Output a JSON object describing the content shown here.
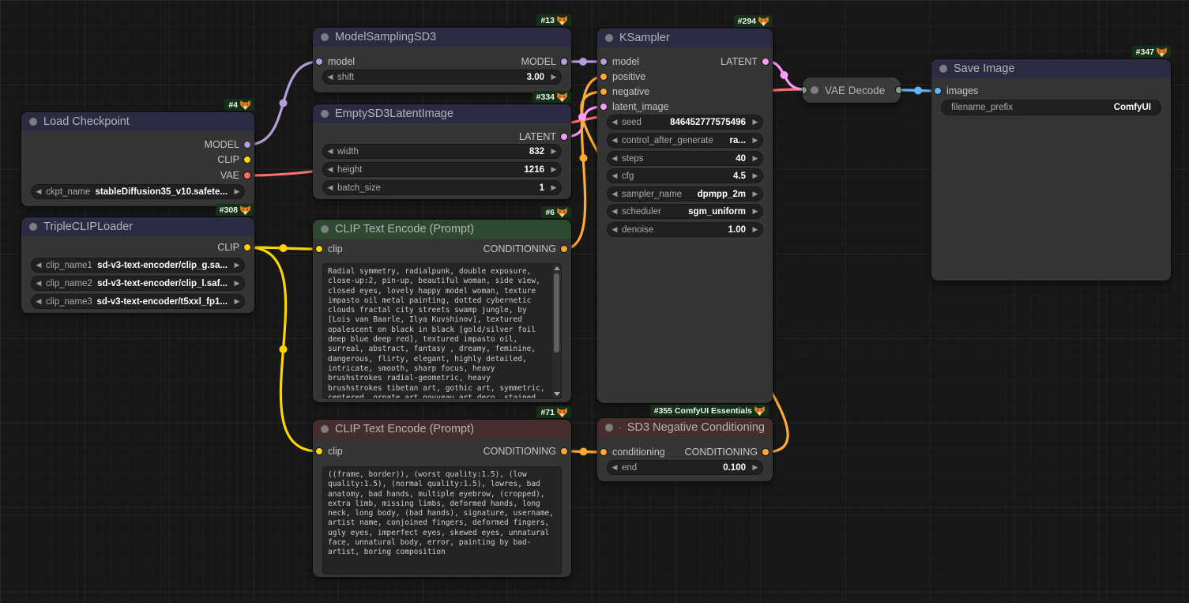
{
  "colors": {
    "model": "#B39DDB",
    "clip": "#FFD500",
    "vae": "#FF6E6E",
    "latent": "#FF9CF9",
    "conditioning": "#FFA931",
    "image": "#64B5F6",
    "collapsed_slot": "#80A080",
    "badge_bg": "#143016",
    "header_default": "#2b2b44",
    "header_positive": "#2d4a31",
    "header_negative": "#472e2e"
  },
  "nodes": {
    "load_checkpoint": {
      "badge": "#4",
      "title": "Load Checkpoint",
      "outputs": [
        "MODEL",
        "CLIP",
        "VAE"
      ],
      "widgets": [
        {
          "label": "ckpt_name",
          "value": "stableDiffusion35_v10.safete..."
        }
      ]
    },
    "triple_clip_loader": {
      "badge": "#308",
      "title": "TripleCLIPLoader",
      "outputs": [
        "CLIP"
      ],
      "widgets": [
        {
          "label": "clip_name1",
          "value": "sd-v3-text-encoder/clip_g.sa..."
        },
        {
          "label": "clip_name2",
          "value": "sd-v3-text-encoder/clip_l.saf..."
        },
        {
          "label": "clip_name3",
          "value": "sd-v3-text-encoder/t5xxl_fp1..."
        }
      ]
    },
    "model_sampling_sd3": {
      "badge": "#13",
      "title": "ModelSamplingSD3",
      "inputs": [
        "model"
      ],
      "outputs": [
        "MODEL"
      ],
      "widgets": [
        {
          "label": "shift",
          "value": "3.00"
        }
      ]
    },
    "empty_latent": {
      "badge": "#334",
      "title": "EmptySD3LatentImage",
      "outputs": [
        "LATENT"
      ],
      "widgets": [
        {
          "label": "width",
          "value": "832"
        },
        {
          "label": "height",
          "value": "1216"
        },
        {
          "label": "batch_size",
          "value": "1"
        }
      ]
    },
    "clip_positive": {
      "badge": "#6",
      "title": "CLIP Text Encode (Prompt)",
      "inputs": [
        "clip"
      ],
      "outputs": [
        "CONDITIONING"
      ],
      "text": "Radial symmetry, radialpunk, double exposure, close-up:2, pin-up, beautiful woman, side view, closed eyes, lovely happy model woman, texture impasto oil metal painting, dotted cybernetic clouds fractal city streets swamp jungle, by [Lois van Baarle, Ilya Kuvshinov], textured opalescent on black in black [gold/silver foil deep blue deep red], textured impasto oil, surreal, abstract, fantasy , dreamy, feminine, dangerous, flirty, elegant, highly detailed, intricate, smooth, sharp focus, heavy brushstrokes radial-geometric, heavy brushstrokes tibetan art, gothic art, symmetric, centered, ornate art nouveau art deco, stained oil art by [ Robert Delaunay, Rufino Tamayo, Picasso, Natalia Ricci, Pino Daeni ] , textured impasto oil heavy brushstrokes [Hsiao Ron Cheng | Giovanni Boldini |"
    },
    "clip_negative": {
      "badge": "#71",
      "title": "CLIP Text Encode (Prompt)",
      "inputs": [
        "clip"
      ],
      "outputs": [
        "CONDITIONING"
      ],
      "text": "((frame, border)), (worst quality:1.5), (low quality:1.5), (normal quality:1.5), lowres, bad anatomy, bad hands, multiple eyebrow, (cropped), extra limb, missing limbs, deformed hands, long neck, long body, (bad hands), signature, username, artist name, conjoined fingers, deformed fingers, ugly eyes, imperfect eyes, skewed eyes, unnatural face, unnatural body, error, painting by bad-artist, boring composition"
    },
    "ksampler": {
      "badge": "#294",
      "title": "KSampler",
      "inputs": [
        "model",
        "positive",
        "negative",
        "latent_image"
      ],
      "outputs": [
        "LATENT"
      ],
      "widgets": [
        {
          "label": "seed",
          "value": "846452777575496"
        },
        {
          "label": "control_after_generate",
          "value": "ra..."
        },
        {
          "label": "steps",
          "value": "40"
        },
        {
          "label": "cfg",
          "value": "4.5"
        },
        {
          "label": "sampler_name",
          "value": "dpmpp_2m"
        },
        {
          "label": "scheduler",
          "value": "sgm_uniform"
        },
        {
          "label": "denoise",
          "value": "1.00"
        }
      ]
    },
    "sd3_negative_conditioning": {
      "badge": "#355 ComfyUI Essentials",
      "title": "SD3 Negative Conditioning",
      "inputs": [
        "conditioning"
      ],
      "outputs": [
        "CONDITIONING"
      ],
      "widgets": [
        {
          "label": "end",
          "value": "0.100"
        }
      ]
    },
    "vae_decode": {
      "title": "VAE Decode"
    },
    "save_image": {
      "badge": "#347",
      "title": "Save Image",
      "inputs": [
        "images"
      ],
      "widgets": [
        {
          "label": "filename_prefix",
          "value": "ComfyUI"
        }
      ]
    }
  }
}
